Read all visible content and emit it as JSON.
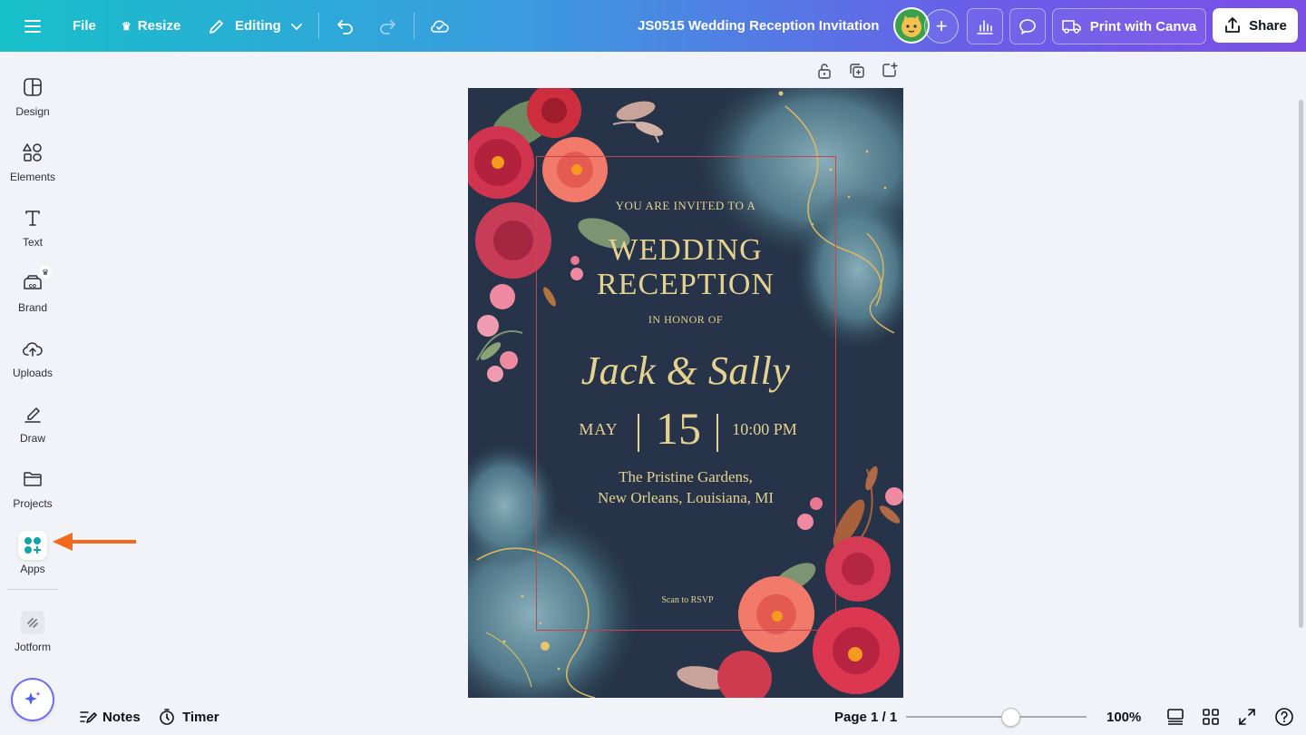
{
  "topbar": {
    "menu_icon": "hamburger-icon",
    "file_label": "File",
    "resize_label": "Resize",
    "editing_label": "Editing",
    "document_title": "JS0515 Wedding Reception Invitation",
    "print_label": "Print with Canva",
    "share_label": "Share",
    "gradient_colors": [
      "#17c0c9",
      "#3b9be0",
      "#7b4fe6"
    ]
  },
  "sidebar": {
    "items": [
      {
        "label": "Design",
        "icon": "design-icon"
      },
      {
        "label": "Elements",
        "icon": "elements-icon"
      },
      {
        "label": "Text",
        "icon": "text-icon"
      },
      {
        "label": "Brand",
        "icon": "brand-icon"
      },
      {
        "label": "Uploads",
        "icon": "upload-cloud-icon"
      },
      {
        "label": "Draw",
        "icon": "draw-pen-icon"
      },
      {
        "label": "Projects",
        "icon": "folder-icon"
      },
      {
        "label": "Apps",
        "icon": "apps-icon"
      },
      {
        "label": "Jotform",
        "icon": "jotform-icon"
      }
    ],
    "annotation_arrow_color": "#f26a1b"
  },
  "invitation": {
    "line1": "YOU ARE INVITED TO A",
    "title_line1": "WEDDING",
    "title_line2": "RECEPTION",
    "in_honor": "IN HONOR OF",
    "names": "Jack & Sally",
    "month": "MAY",
    "day": "15",
    "time": "10:00 PM",
    "venue_line1": "The Pristine Gardens,",
    "venue_line2": "New Orleans, Louisiana, MI",
    "rsvp": "Scan to RSVP",
    "background_color": "#263348",
    "text_color": "#e6d28f",
    "frame_color": "#c4434f"
  },
  "bottombar": {
    "notes_label": "Notes",
    "timer_label": "Timer",
    "page_label": "Page 1 / 1",
    "zoom_label": "100%",
    "zoom_level": 0.53
  }
}
